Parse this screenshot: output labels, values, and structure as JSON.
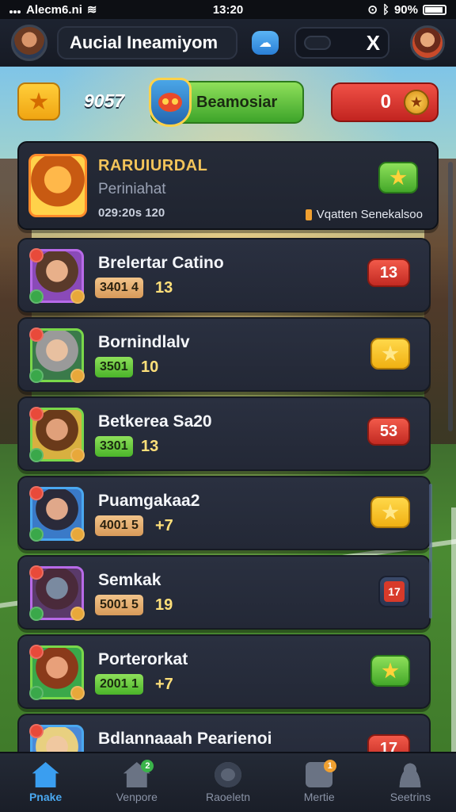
{
  "status": {
    "carrier": "Alecm6.ni",
    "time": "13:20",
    "battery": "90%"
  },
  "header": {
    "title": "Aucial Ineamiyom",
    "close_glyph": "X"
  },
  "resources": {
    "score": "9057",
    "button_label": "Beamosiar",
    "red_value": "0"
  },
  "featured": {
    "name": "RARUIURDAL",
    "subtitle": "Periniahat",
    "stat": "029:20s 120",
    "note": "Vqatten Senekalsoo"
  },
  "players": [
    {
      "name": "Brelertar Catino",
      "stat": "3401 4",
      "level": "13",
      "action": "13",
      "action_style": "red",
      "border": "#b86ae8"
    },
    {
      "name": "Bornindlalv",
      "stat": "3501",
      "level": "10",
      "action": "",
      "action_style": "yellow",
      "border": "#7ad84a"
    },
    {
      "name": "Betkerea Sa20",
      "stat": "3301",
      "level": "13",
      "action": "53",
      "action_style": "red",
      "border": "#7ad84a"
    },
    {
      "name": "Puamgakaa2",
      "stat": "4001 5",
      "level": "+7",
      "action": "",
      "action_style": "yellow",
      "border": "#4aa8f0"
    },
    {
      "name": "Semkak",
      "stat": "5001 5",
      "level": "19",
      "action": "17",
      "action_style": "dark-red",
      "border": "#b86ae8"
    },
    {
      "name": "Porterorkat",
      "stat": "2001 1",
      "level": "+7",
      "action": "",
      "action_style": "green",
      "border": "#7ad84a"
    },
    {
      "name": "Bdlannaaah Pearienoi",
      "stat": "",
      "level": "",
      "action": "17",
      "action_style": "red",
      "border": "#4aa8f0"
    }
  ],
  "nav": [
    {
      "label": "Pnake",
      "icon": "home-icon",
      "active": true
    },
    {
      "label": "Venpore",
      "icon": "house-icon",
      "badge": "2"
    },
    {
      "label": "Raoeletn",
      "icon": "gear-icon"
    },
    {
      "label": "Mertie",
      "icon": "box-icon",
      "badge": "1"
    },
    {
      "label": "Seetrins",
      "icon": "user-icon"
    }
  ],
  "colors": {
    "accent": "#3a9ef0",
    "gold": "#f3c45a",
    "green": "#4ab42a",
    "red": "#d83a2a"
  }
}
